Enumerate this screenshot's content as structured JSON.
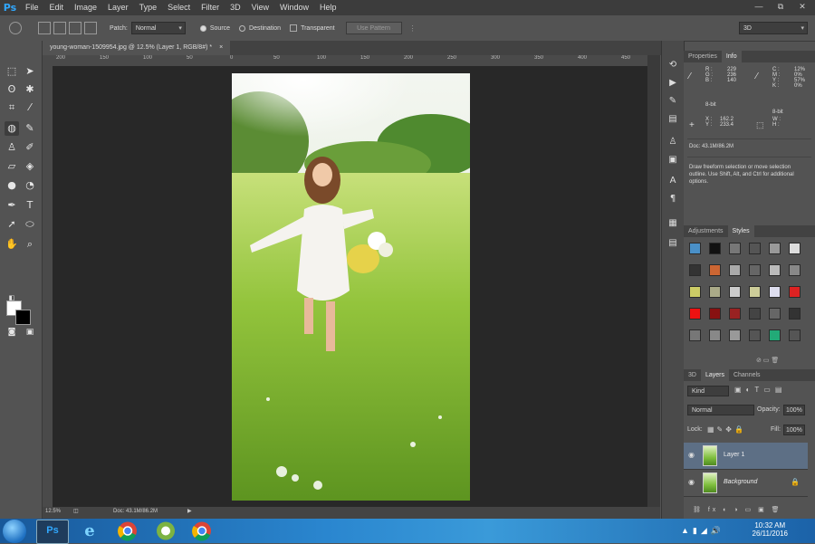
{
  "app": {
    "logo": "Ps"
  },
  "menu": [
    "File",
    "Edit",
    "Image",
    "Layer",
    "Type",
    "Select",
    "Filter",
    "3D",
    "View",
    "Window",
    "Help"
  ],
  "window_controls": [
    "—",
    "⧉",
    "✕"
  ],
  "options_bar": {
    "patch_label": "Patch:",
    "patch_mode": "Normal",
    "source_label": "Source",
    "destination_label": "Destination",
    "transparent_label": "Transparent",
    "use_pattern_label": "Use Pattern",
    "workspace": "3D"
  },
  "document": {
    "tab_title": "young-woman-1509954.jpg @ 12.5% (Layer 1, RGB/8#) *",
    "close": "×"
  },
  "ruler_ticks": [
    "200",
    "150",
    "100",
    "50",
    "0",
    "50",
    "100",
    "150",
    "200",
    "250",
    "300",
    "350",
    "400",
    "450"
  ],
  "status": {
    "zoom": "12.5%",
    "doc": "Doc: 43.1M/86.2M"
  },
  "panels": {
    "top_tabs": [
      "Properties",
      "Info"
    ],
    "info": {
      "rgb_labels": "R :\nG :\nB :",
      "rgb_values": "229\n236\n140",
      "cmyk_labels": "C :\nM :\nY :\nK :",
      "cmyk_values": "12%\n0%\n57%\n0%",
      "bit_left": "8-bit",
      "bit_right": "8-bit",
      "xy_labels": "X :\nY :",
      "xy_values": "162.2\n233.4",
      "wh_labels": "W :\nH :",
      "doc": "Doc: 43.1M/86.2M",
      "hint": "Draw freeform selection or move selection outline.  Use Shift, Alt, and Ctrl for additional options."
    },
    "mid_tabs": [
      "Adjustments",
      "Styles"
    ],
    "layer_tabs": [
      "3D",
      "Layers",
      "Channels"
    ],
    "layers": {
      "kind_filter": "Kind",
      "blend_mode": "Normal",
      "opacity_label": "Opacity:",
      "opacity_value": "100%",
      "lock_label": "Lock:",
      "fill_label": "Fill:",
      "fill_value": "100%",
      "items": [
        {
          "name": "Layer 1",
          "selected": true
        },
        {
          "name": "Background",
          "selected": false
        }
      ],
      "footer_icons": "⛓ fx ◐ ◑ ▭ ▣ 🗑"
    }
  },
  "taskbar": {
    "apps": [
      "photoshop-icon",
      "ie-icon",
      "chrome-icon",
      "app-icon",
      "chrome-icon-2"
    ],
    "time": "10:32 AM",
    "date": "26/11/2016"
  },
  "colors": {
    "accent": "#31a8ff",
    "canvas_bg": "#282828",
    "ui_bg": "#535353"
  }
}
